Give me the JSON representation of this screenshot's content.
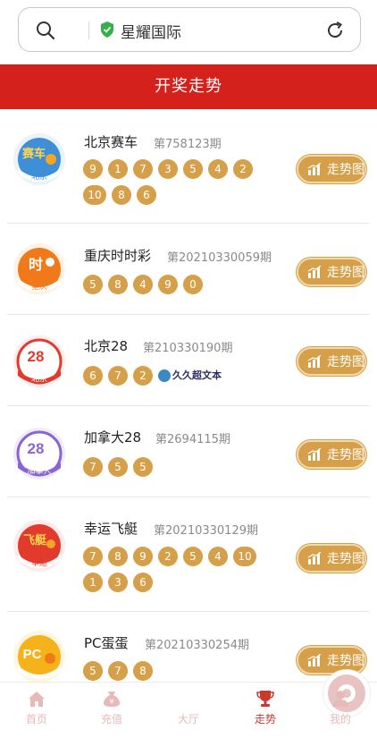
{
  "browser": {
    "site_name": "星耀国际",
    "icons": [
      "search-icon",
      "shield-check-icon",
      "reload-icon"
    ]
  },
  "header": {
    "title": "开奖走势"
  },
  "lotteries": [
    {
      "name": "北京赛车",
      "period": "第758123期",
      "logo_text": "赛车",
      "logo_sub": "北京",
      "logo_color": "#3f8fd8",
      "numbers": [
        "9",
        "1",
        "7",
        "3",
        "5",
        "4",
        "2",
        "10",
        "8",
        "6"
      ],
      "button": "走势图"
    },
    {
      "name": "重庆时时彩",
      "period": "第20210330059期",
      "logo_text": "时",
      "logo_sub": "重庆",
      "logo_color": "#f07a1a",
      "numbers": [
        "5",
        "8",
        "4",
        "9",
        "0"
      ],
      "button": "走势图"
    },
    {
      "name": "北京28",
      "period": "第210330190期",
      "logo_text": "28",
      "logo_sub": "北京",
      "logo_color": "#e23b2e",
      "numbers": [
        "6",
        "7",
        "2"
      ],
      "button": "走势图",
      "watermark": "久久超文本"
    },
    {
      "name": "加拿大28",
      "period": "第2694115期",
      "logo_text": "28",
      "logo_sub": "加拿大",
      "logo_color": "#8a64d6",
      "numbers": [
        "7",
        "5",
        "5"
      ],
      "button": "走势图"
    },
    {
      "name": "幸运飞艇",
      "period": "第20210330129期",
      "logo_text": "飞艇",
      "logo_sub": "幸运",
      "logo_color": "#e23b2e",
      "numbers": [
        "7",
        "8",
        "9",
        "2",
        "5",
        "4",
        "10",
        "1",
        "3",
        "6"
      ],
      "button": "走势图"
    },
    {
      "name": "PC蛋蛋",
      "period": "第20210330254期",
      "logo_text": "PC",
      "logo_sub": "",
      "logo_color": "#f5b21a",
      "numbers": [
        "5",
        "7",
        "8"
      ],
      "button": "走势图"
    }
  ],
  "tabbar": {
    "items": [
      {
        "label": "首页",
        "icon": "home-icon",
        "active": false
      },
      {
        "label": "充值",
        "icon": "money-bag-icon",
        "active": false
      },
      {
        "label": "大厅",
        "icon": "lobby-ball-icon",
        "active": false
      },
      {
        "label": "走势",
        "icon": "trophy-icon",
        "active": true
      },
      {
        "label": "我的",
        "icon": "user-icon",
        "active": false
      }
    ]
  },
  "colors": {
    "header_red": "#d4211c",
    "gold": "#d6a04a",
    "tab_active": "#c9392d",
    "tab_inactive": "#e8b9b9"
  }
}
